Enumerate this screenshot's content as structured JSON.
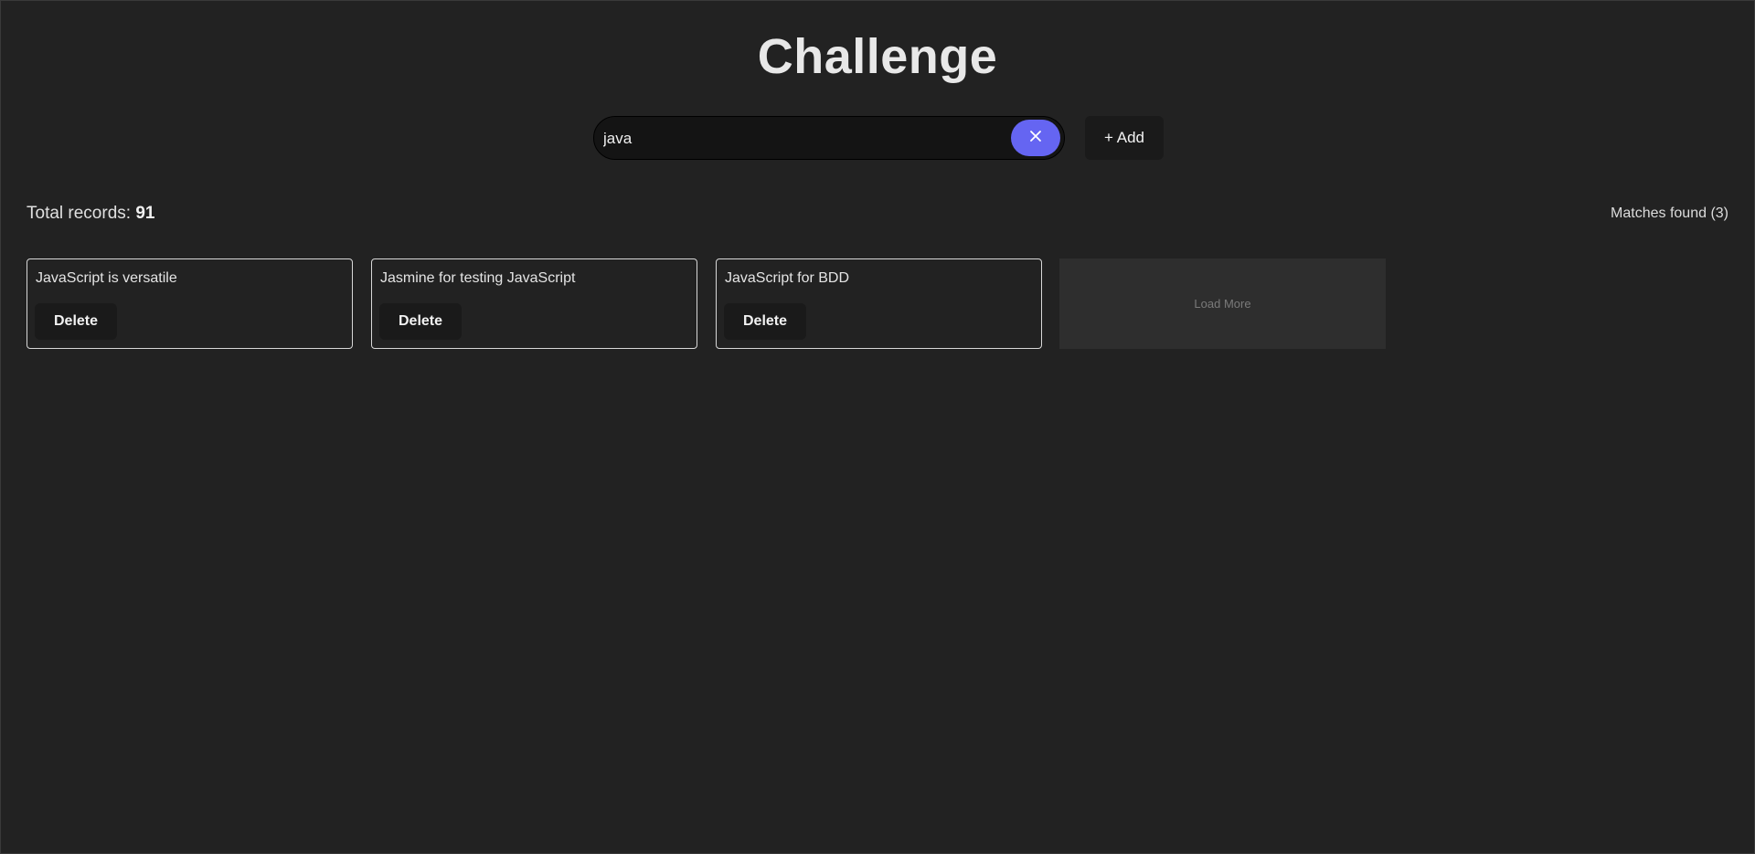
{
  "app": {
    "title": "Challenge"
  },
  "search": {
    "value": "java",
    "placeholder": ""
  },
  "toolbar": {
    "add_label": "+ Add",
    "clear_icon": "close-icon"
  },
  "stats": {
    "total_label": "Total records: ",
    "total_value": "91",
    "matches_label": "Matches found (3)"
  },
  "records": [
    {
      "text": "JavaScript is versatile",
      "delete_label": "Delete"
    },
    {
      "text": "Jasmine for testing JavaScript",
      "delete_label": "Delete"
    },
    {
      "text": "JavaScript for BDD",
      "delete_label": "Delete"
    }
  ],
  "load_more": {
    "label": "Load More"
  },
  "colors": {
    "background": "#222222",
    "accent": "#6565f2",
    "button_bg": "#1a1a1a",
    "card_border": "#d8d8d8"
  }
}
